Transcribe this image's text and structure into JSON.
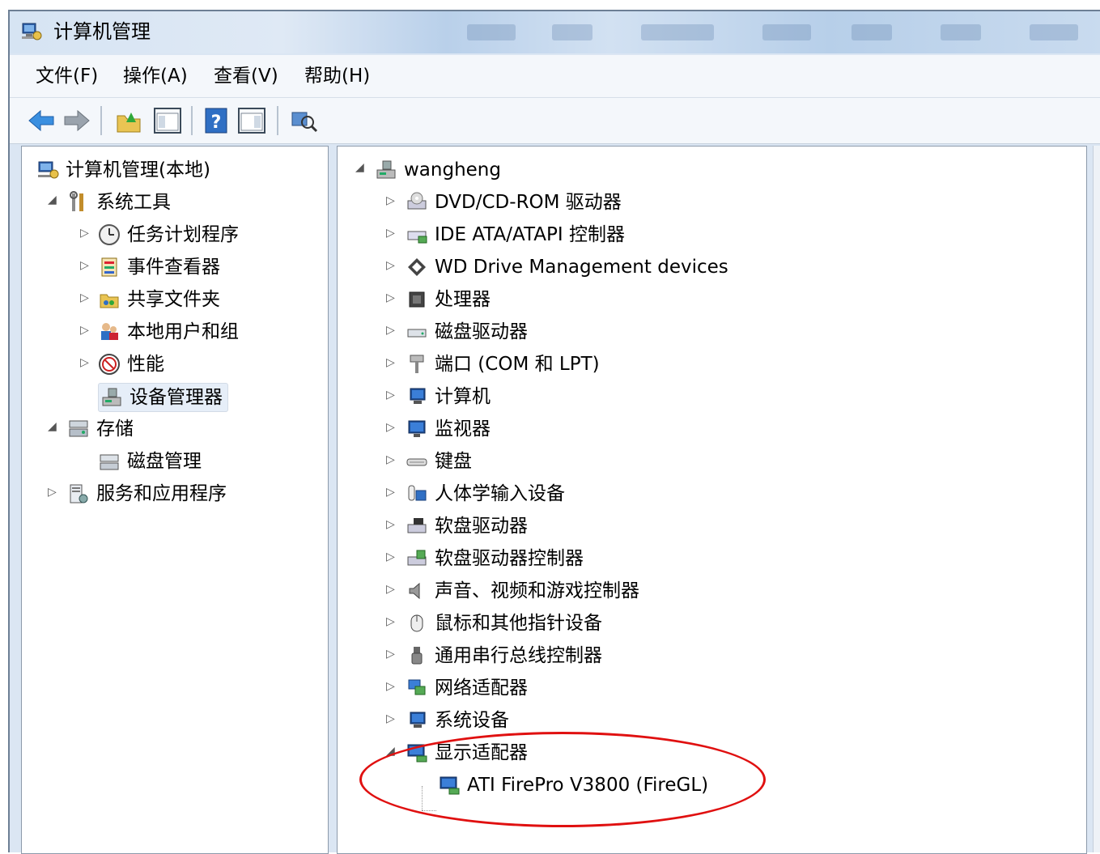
{
  "window": {
    "title": "计算机管理"
  },
  "menu": [
    "文件(F)",
    "操作(A)",
    "查看(V)",
    "帮助(H)"
  ],
  "tree": {
    "root": "计算机管理(本地)",
    "system_tools": "系统工具",
    "task_scheduler": "任务计划程序",
    "event_viewer": "事件查看器",
    "shared_folders": "共享文件夹",
    "local_users": "本地用户和组",
    "performance": "性能",
    "device_manager": "设备管理器",
    "storage": "存储",
    "disk_management": "磁盘管理",
    "services": "服务和应用程序"
  },
  "devices": {
    "computer_name": "wangheng",
    "categories": [
      "DVD/CD-ROM 驱动器",
      "IDE ATA/ATAPI 控制器",
      "WD Drive Management devices",
      "处理器",
      "磁盘驱动器",
      "端口 (COM 和 LPT)",
      "计算机",
      "监视器",
      "键盘",
      "人体学输入设备",
      "软盘驱动器",
      "软盘驱动器控制器",
      "声音、视频和游戏控制器",
      "鼠标和其他指针设备",
      "通用串行总线控制器",
      "网络适配器",
      "系统设备",
      "显示适配器"
    ],
    "display_adapter": "ATI FirePro V3800 (FireGL)"
  },
  "colors": {
    "annotation": "#e01010",
    "selection": "#e6eef8",
    "accent": "#2f6fc4"
  }
}
